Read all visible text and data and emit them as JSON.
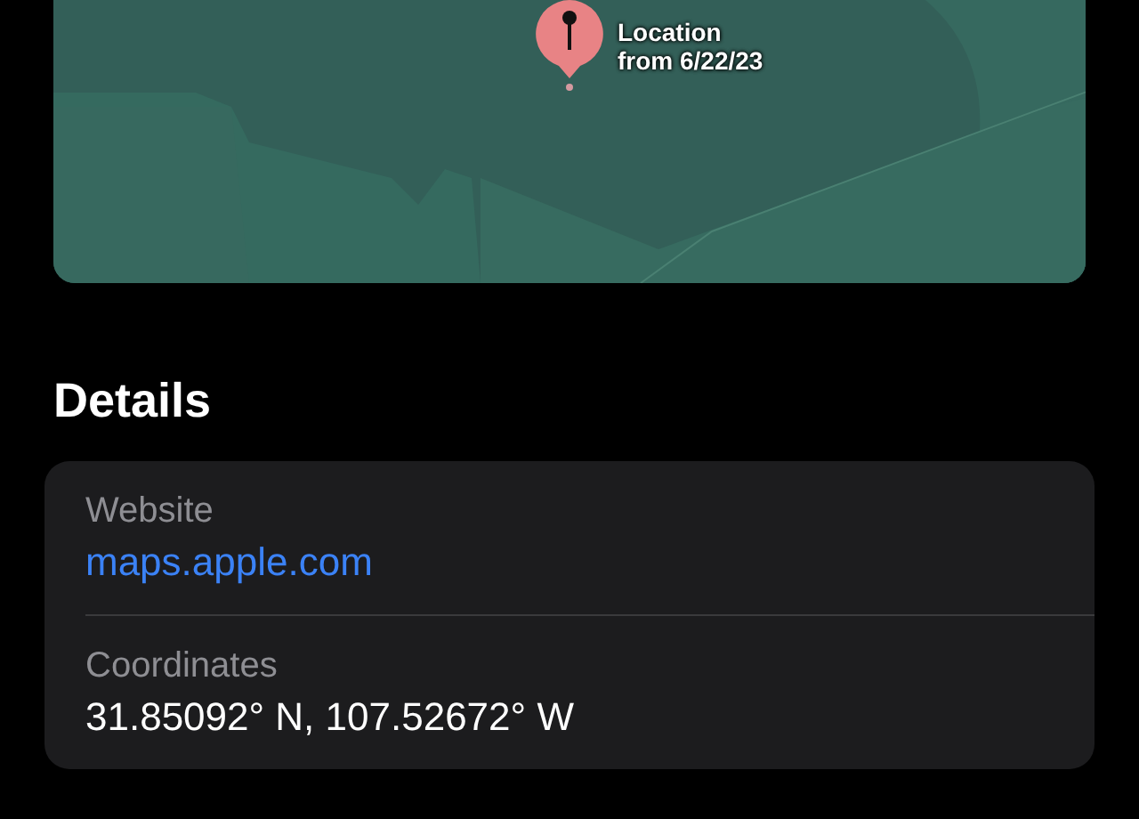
{
  "map": {
    "kind": "picture",
    "pin": {
      "label": "Location",
      "sublabel": "from 6/22/23"
    }
  },
  "details": {
    "title": "Details",
    "rows": [
      {
        "kind": "link",
        "label": "Website",
        "value": "maps.apple.com"
      },
      {
        "kind": "text",
        "label": "Coordinates",
        "value": "31.85092° N, 107.52672° W"
      }
    ]
  }
}
